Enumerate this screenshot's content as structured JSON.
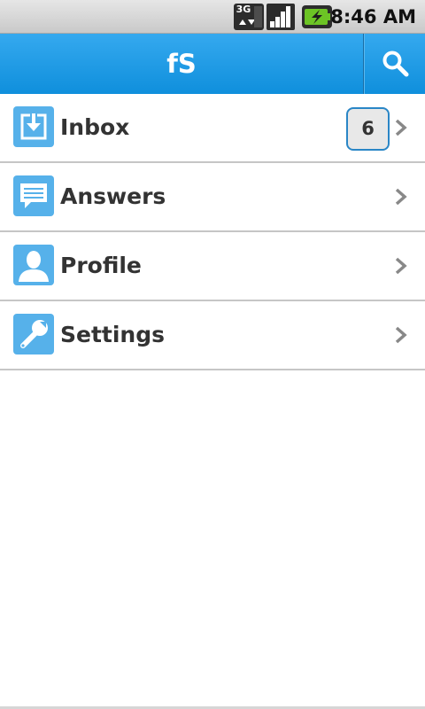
{
  "status_bar": {
    "time": "8:46 AM",
    "network_label": "3G",
    "icons": [
      "network-3g-icon",
      "signal-strength-icon",
      "battery-charging-icon"
    ]
  },
  "header": {
    "title": "fS",
    "search_icon": "search-icon",
    "color": "#1a9be6"
  },
  "menu": {
    "items": [
      {
        "label": "Inbox",
        "icon": "inbox-download-icon",
        "badge": "6"
      },
      {
        "label": "Answers",
        "icon": "speech-bubble-icon"
      },
      {
        "label": "Profile",
        "icon": "person-icon"
      },
      {
        "label": "Settings",
        "icon": "wrench-icon"
      }
    ]
  },
  "colors": {
    "accent": "#1a9be6",
    "icon_tile": "#56b1ea",
    "badge_border": "#2a86c6"
  }
}
